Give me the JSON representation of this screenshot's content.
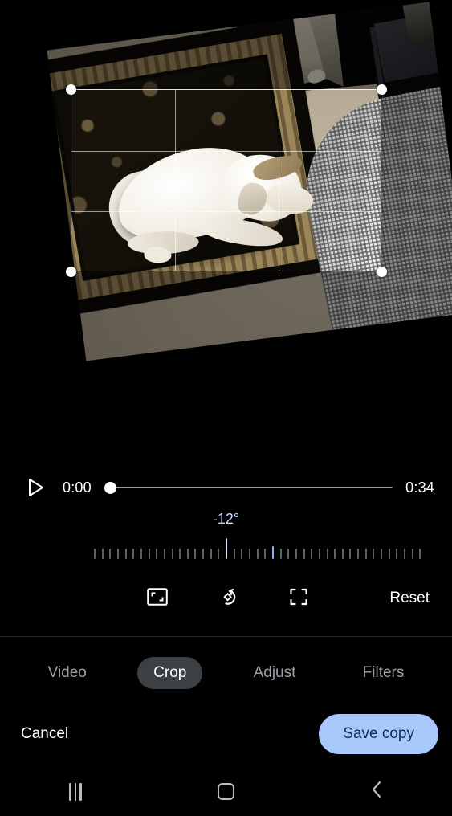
{
  "editor": {
    "playback": {
      "play_icon": "play-triangle-icon",
      "current_time": "0:00",
      "total_time": "0:34",
      "progress_percent": 0
    },
    "rotation": {
      "value_label": "-12°",
      "degrees": -12,
      "tick_count": 43,
      "current_tick_index": 17,
      "zero_tick_index": 23,
      "accent_color": "#8ab4f8",
      "value_color": "#c6dafc"
    },
    "tools": [
      {
        "name": "aspect-ratio-icon",
        "label": "Aspect ratio"
      },
      {
        "name": "rotate-icon",
        "label": "Rotate"
      },
      {
        "name": "free-crop-icon",
        "label": "Free crop"
      }
    ],
    "reset_label": "Reset",
    "tabs": [
      {
        "label": "Video",
        "active": false
      },
      {
        "label": "Crop",
        "active": true
      },
      {
        "label": "Adjust",
        "active": false
      },
      {
        "label": "Filters",
        "active": false
      }
    ],
    "actions": {
      "cancel_label": "Cancel",
      "save_label": "Save copy",
      "save_bg": "#a8c7fa",
      "save_fg": "#0b2a5b"
    },
    "crop_overlay": {
      "handle_color": "#ffffff",
      "grid_lines": 2,
      "handles": 4
    },
    "photo": {
      "alt": "White dog lying on an ornate dark floral rug beside a checkered bed skirt",
      "rotation_deg": -7.2
    }
  },
  "navbar": {
    "items": [
      {
        "name": "recents-icon",
        "label": "Recents"
      },
      {
        "name": "home-icon",
        "label": "Home"
      },
      {
        "name": "back-icon",
        "label": "Back"
      }
    ]
  }
}
